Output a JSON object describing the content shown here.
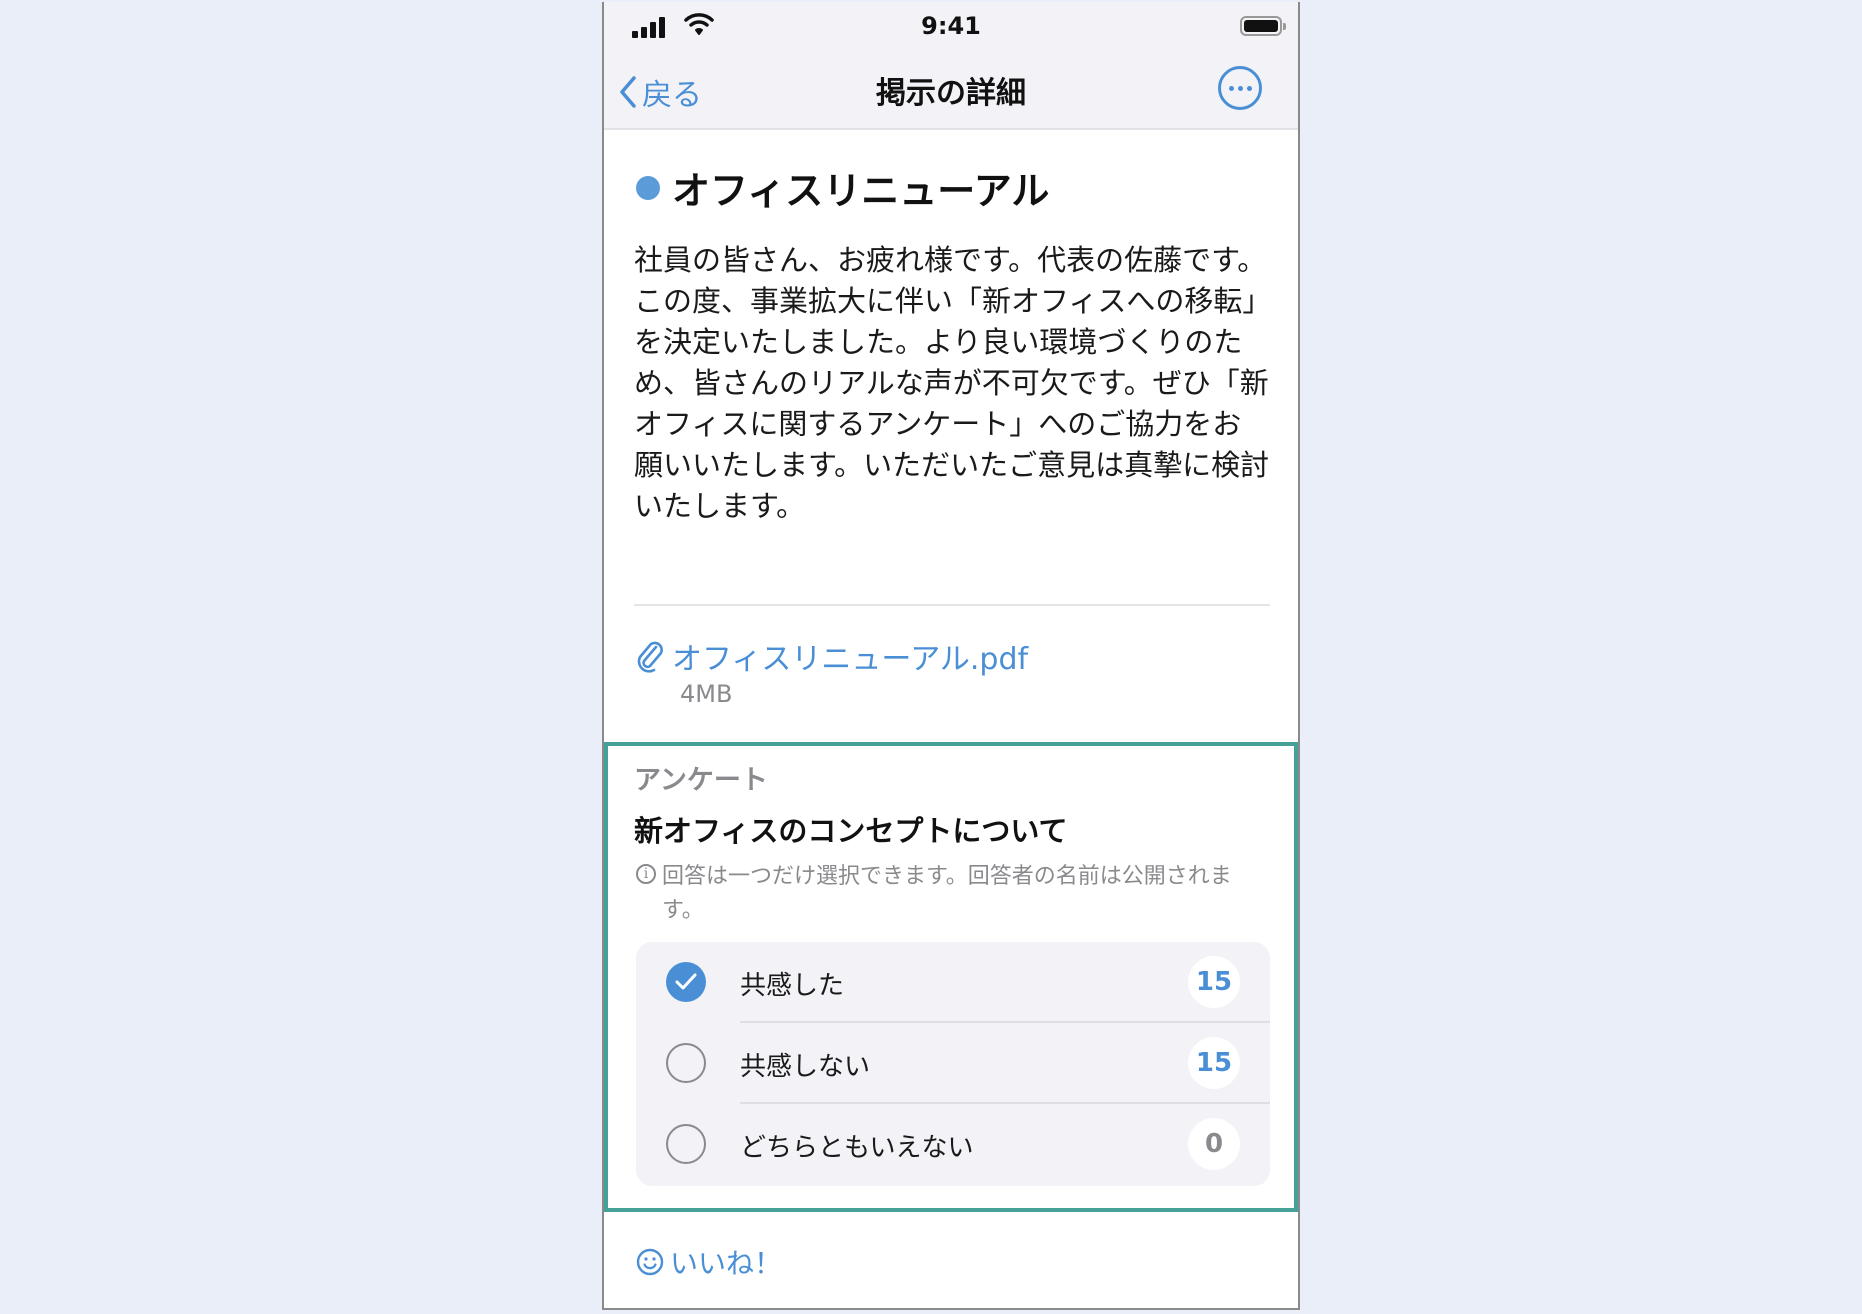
{
  "status_bar": {
    "time": "9:41"
  },
  "nav": {
    "back_label": "戻る",
    "title": "掲示の詳細"
  },
  "post": {
    "title": "オフィスリニューアル",
    "body": "社員の皆さん、お疲れ様です。代表の佐藤です。\nこの度、事業拡大に伴い「新オフィスへの移転」を決定いたしました。より良い環境づくりのため、皆さんのリアルな声が不可欠です。ぜひ「新オフィスに関するアンケート」へのご協力をお願いいたします。いただいたご意見は真摯に検討いたします。",
    "attachment": {
      "name": "オフィスリニューアル.pdf",
      "size": "4MB"
    }
  },
  "survey": {
    "label": "アンケート",
    "question": "新オフィスのコンセプトについて",
    "note": "回答は一つだけ選択できます。回答者の名前は公開されます。",
    "options": [
      {
        "label": "共感した",
        "count": "15",
        "selected": true
      },
      {
        "label": "共感しない",
        "count": "15",
        "selected": false
      },
      {
        "label": "どちらともいえない",
        "count": "0",
        "selected": false
      }
    ]
  },
  "like": {
    "label": "いいね！"
  },
  "colors": {
    "accent": "#4a8fd6",
    "highlight_border": "#45a198",
    "background": "#e9eef9",
    "zero_count": "#8a8a8e"
  }
}
